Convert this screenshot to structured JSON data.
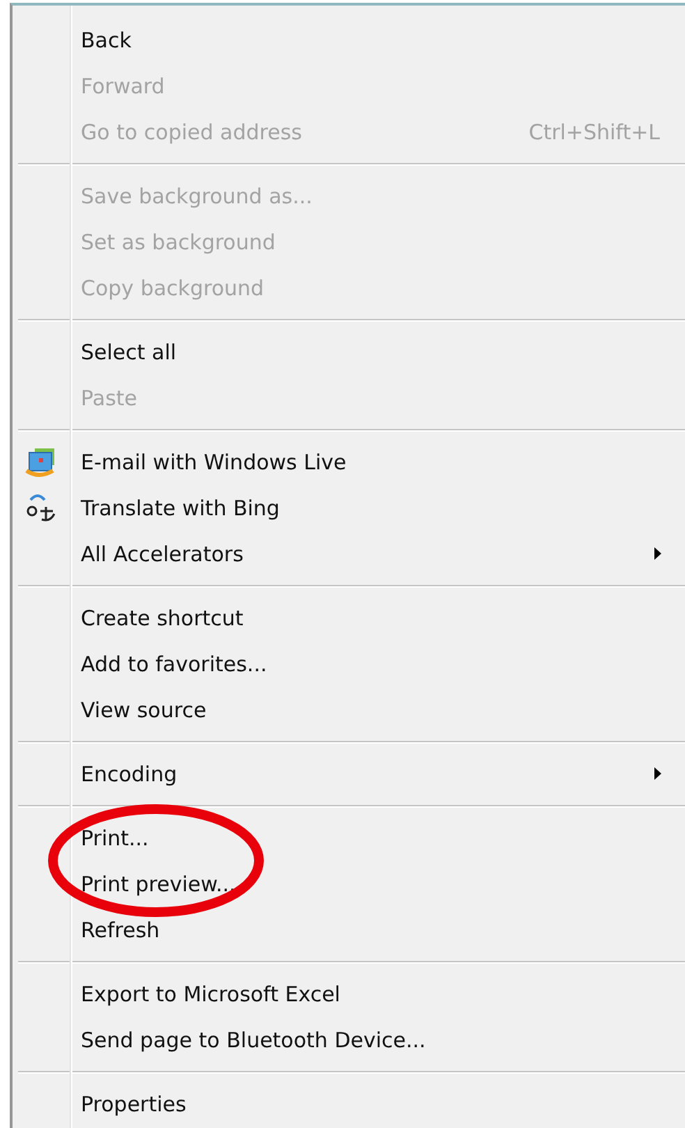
{
  "menu": {
    "groups": [
      {
        "items": [
          {
            "label": "Back",
            "disabled": false
          },
          {
            "label": "Forward",
            "disabled": true
          },
          {
            "label": "Go to copied address",
            "disabled": true,
            "shortcut": "Ctrl+Shift+L"
          }
        ]
      },
      {
        "items": [
          {
            "label": "Save background as...",
            "disabled": true
          },
          {
            "label": "Set as background",
            "disabled": true
          },
          {
            "label": "Copy background",
            "disabled": true
          }
        ]
      },
      {
        "items": [
          {
            "label": "Select all",
            "disabled": false
          },
          {
            "label": "Paste",
            "disabled": true
          }
        ]
      },
      {
        "items": [
          {
            "label": "E-mail with Windows Live",
            "disabled": false,
            "kind": "accelerator"
          },
          {
            "label": "Translate with Bing",
            "disabled": false,
            "kind": "accelerator"
          },
          {
            "label": "All Accelerators",
            "disabled": false,
            "submenu": true
          }
        ]
      },
      {
        "items": [
          {
            "label": "Create shortcut",
            "disabled": false
          },
          {
            "label": "Add to favorites...",
            "disabled": false
          },
          {
            "label": "View source",
            "disabled": false
          }
        ]
      },
      {
        "items": [
          {
            "label": "Encoding",
            "disabled": false,
            "submenu": true
          }
        ]
      },
      {
        "items": [
          {
            "label": "Print...",
            "disabled": false
          },
          {
            "label": "Print preview...",
            "disabled": false
          },
          {
            "label": "Refresh",
            "disabled": false
          }
        ]
      },
      {
        "items": [
          {
            "label": "Export to Microsoft Excel",
            "disabled": false
          },
          {
            "label": "Send page to Bluetooth Device...",
            "disabled": false
          }
        ]
      },
      {
        "items": [
          {
            "label": "Properties",
            "disabled": false
          }
        ]
      }
    ]
  }
}
